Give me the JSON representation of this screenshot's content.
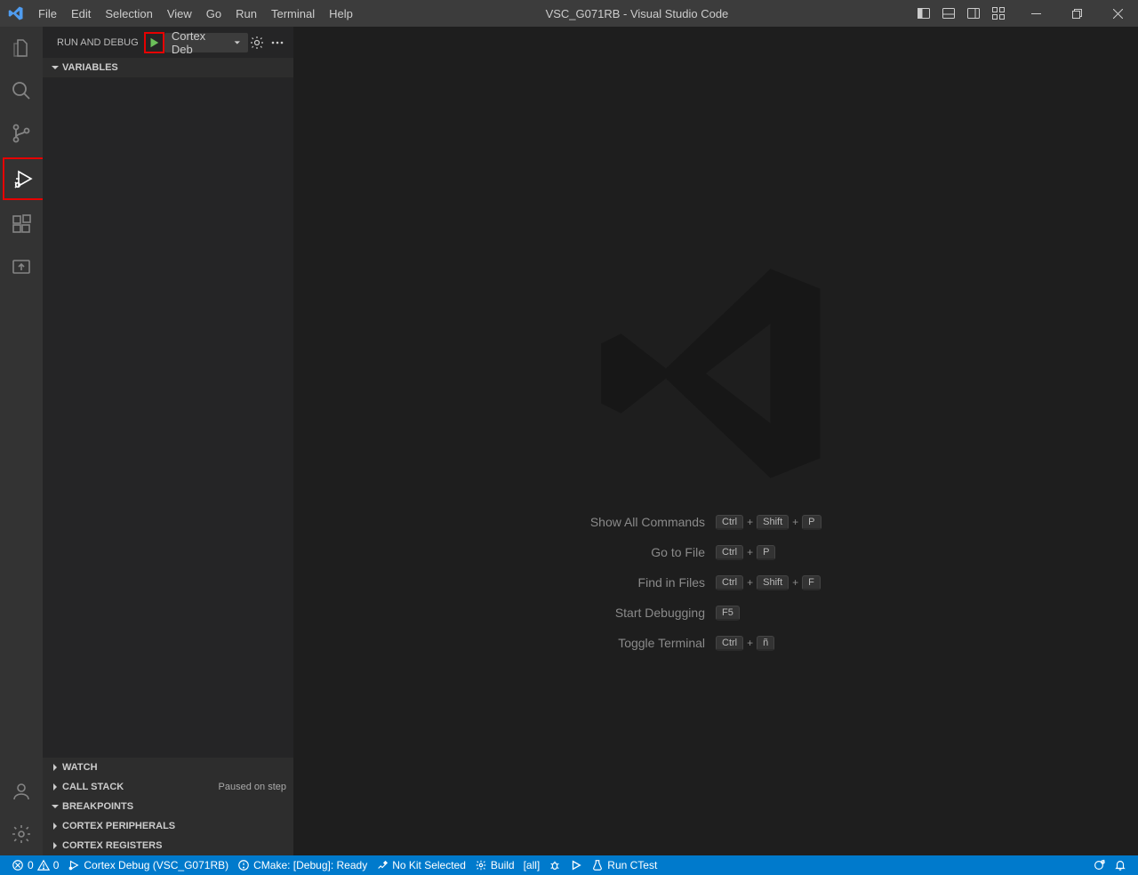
{
  "titlebar": {
    "menus": [
      "File",
      "Edit",
      "Selection",
      "View",
      "Go",
      "Run",
      "Terminal",
      "Help"
    ],
    "title": "VSC_G071RB - Visual Studio Code"
  },
  "sidebar": {
    "headerLabel": "RUN AND DEBUG",
    "configName": "Cortex Deb",
    "sections": {
      "variables": "VARIABLES",
      "watch": "WATCH",
      "callstack": "CALL STACK",
      "callstackStatus": "Paused on step",
      "breakpoints": "BREAKPOINTS",
      "cortexPeripherals": "CORTEX PERIPHERALS",
      "cortexRegisters": "CORTEX REGISTERS"
    }
  },
  "editorHints": [
    {
      "label": "Show All Commands",
      "keys": [
        "Ctrl",
        "+",
        "Shift",
        "+",
        "P"
      ]
    },
    {
      "label": "Go to File",
      "keys": [
        "Ctrl",
        "+",
        "P"
      ]
    },
    {
      "label": "Find in Files",
      "keys": [
        "Ctrl",
        "+",
        "Shift",
        "+",
        "F"
      ]
    },
    {
      "label": "Start Debugging",
      "keys": [
        "F5"
      ]
    },
    {
      "label": "Toggle Terminal",
      "keys": [
        "Ctrl",
        "+",
        "ñ"
      ]
    }
  ],
  "statusbar": {
    "errors": "0",
    "warnings": "0",
    "debugTarget": "Cortex Debug (VSC_G071RB)",
    "cmakeStatus": "CMake: [Debug]: Ready",
    "kit": "No Kit Selected",
    "build": "Build",
    "target": "[all]",
    "ctest": "Run CTest"
  }
}
